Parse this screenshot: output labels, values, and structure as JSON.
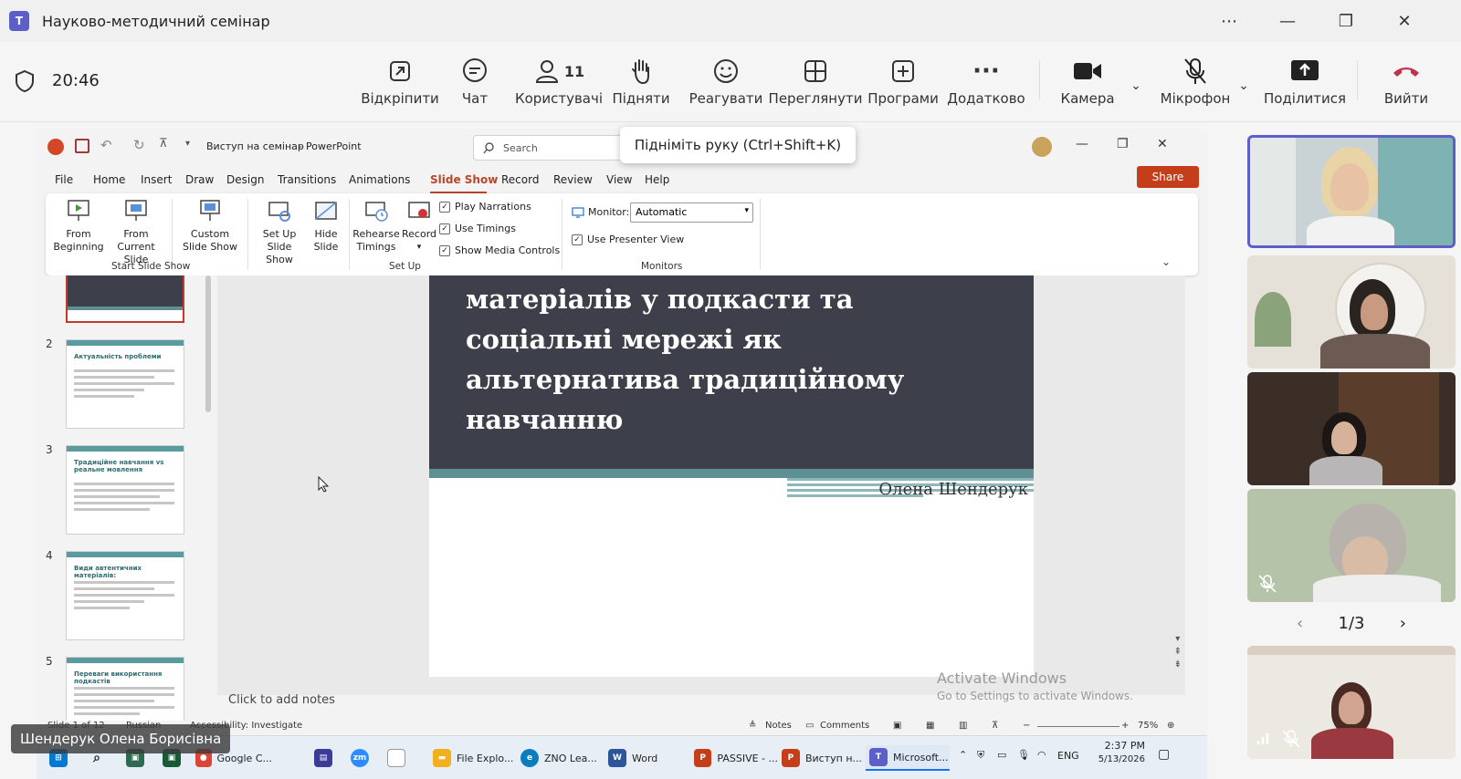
{
  "teams": {
    "window_title": "Науково-методичний семінар",
    "clock": "20:46",
    "toolbar": [
      {
        "label": "Відкріпити",
        "icon": "unpin-icon"
      },
      {
        "label": "Чат",
        "icon": "chat-icon"
      },
      {
        "label": "Користувачі",
        "icon": "people-icon",
        "count": "11"
      },
      {
        "label": "Підняти",
        "icon": "raise-hand-icon"
      },
      {
        "label": "Реагувати",
        "icon": "react-icon"
      },
      {
        "label": "Переглянути",
        "icon": "view-icon"
      },
      {
        "label": "Програми",
        "icon": "apps-icon"
      },
      {
        "label": "Додатково",
        "icon": "more-icon"
      }
    ],
    "camera_label": "Камера",
    "mic_label": "Мікрофон",
    "share_label": "Поділитися",
    "leave_label": "Вийти",
    "tooltip": "Підніміть руку (Ctrl+Shift+K)",
    "presenter_name": "Шендерук Олена Борисівна",
    "pager": "1/3"
  },
  "powerpoint": {
    "doc_title": "Виступ на семінар",
    "app_name": "PowerPoint",
    "search_placeholder": "Search",
    "menu": [
      "File",
      "Home",
      "Insert",
      "Draw",
      "Design",
      "Transitions",
      "Animations",
      "Slide Show",
      "Record",
      "Review",
      "View",
      "Help"
    ],
    "active_menu": "Slide Show",
    "share_button": "Share",
    "ribbon": {
      "from_beginning": "From Beginning",
      "from_current": "From Current Slide",
      "custom_show": "Custom Slide Show",
      "setup_show": "Set Up Slide Show",
      "hide_slide": "Hide Slide",
      "rehearse": "Rehearse Timings",
      "record": "Record",
      "play_narrations": "Play Narrations",
      "use_timings": "Use Timings",
      "show_media_controls": "Show Media Controls",
      "monitor_label": "Monitor:",
      "monitor_value": "Automatic",
      "use_presenter_view": "Use Presenter View",
      "group_start": "Start Slide Show",
      "group_setup": "Set Up",
      "group_monitors": "Monitors"
    },
    "thumbnails": [
      {
        "num": "2",
        "title": "Актуальність проблеми"
      },
      {
        "num": "3",
        "title": "Традиційне навчання vs реальне мовлення"
      },
      {
        "num": "4",
        "title": "Види автентичних матеріалів:"
      },
      {
        "num": "5",
        "title": "Переваги використання подкастів"
      }
    ],
    "slide": {
      "title_lines": [
        "матеріалів у подкасти та",
        "соціальні мережі як",
        "альтернатива традиційному",
        "навчанню"
      ],
      "author": "Олена Шендерук"
    },
    "notes_placeholder": "Click to add notes",
    "activate_title": "Activate Windows",
    "activate_sub": "Go to Settings to activate Windows.",
    "status": {
      "slide_counter": "Slide 1 of 12",
      "language": "Russian",
      "accessibility": "Accessibility: Investigate",
      "notes": "Notes",
      "comments": "Comments",
      "zoom": "75%"
    }
  },
  "taskbar": {
    "apps": [
      {
        "label": "Google C...",
        "color": "#db4437"
      },
      {
        "label": "File Explo...",
        "color": "#f2b01e"
      },
      {
        "label": "ZNO Lea...",
        "color": "#0b7dbf"
      },
      {
        "label": "Word",
        "color": "#2b579a"
      },
      {
        "label": "PASSIVE - ...",
        "color": "#c43e1c"
      },
      {
        "label": "Виступ н...",
        "color": "#c43e1c"
      },
      {
        "label": "Microsoft...",
        "color": "#5b5fc7"
      }
    ],
    "lang": "ENG",
    "time": "2:37 PM",
    "date": "5/13/2026"
  }
}
